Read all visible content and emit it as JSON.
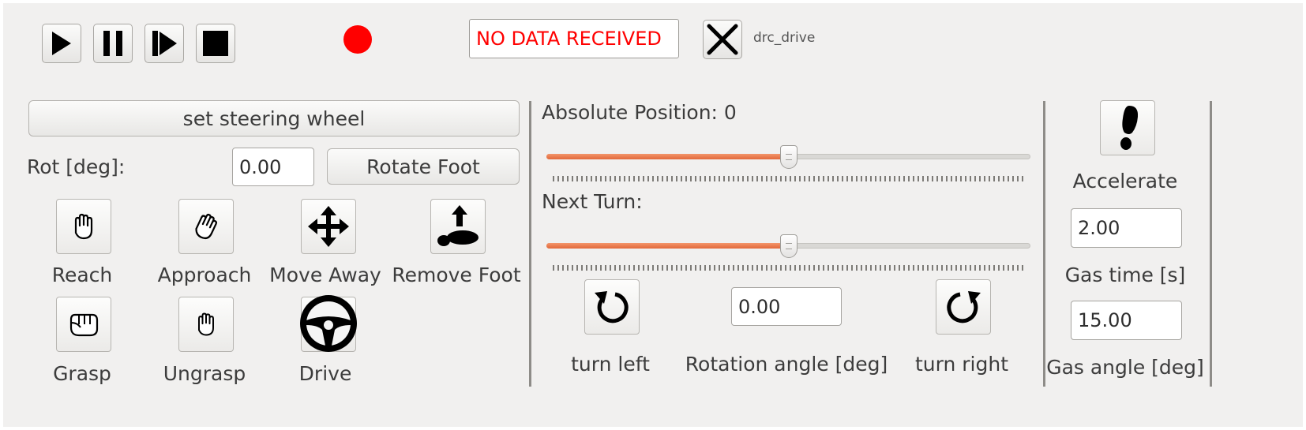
{
  "toolbar": {
    "status_text": "NO DATA RECEIVED",
    "plugin_name": "drc_drive",
    "status_color": "#ff0000",
    "record_indicator_color": "#ff0000"
  },
  "left": {
    "set_steering_wheel_label": "set steering wheel",
    "rot_label": "Rot [deg]:",
    "rot_value": "0.00",
    "rotate_foot_label": "Rotate Foot",
    "actions": [
      {
        "label": "Reach"
      },
      {
        "label": "Approach"
      },
      {
        "label": "Move Away"
      },
      {
        "label": "Remove Foot"
      },
      {
        "label": "Grasp"
      },
      {
        "label": "Ungrasp"
      },
      {
        "label": "Drive"
      }
    ]
  },
  "middle": {
    "absolute_position_label": "Absolute Position: 0",
    "absolute_position_slider": 0.5,
    "next_turn_label": "Next Turn:",
    "next_turn_slider": 0.5,
    "turn_left_label": "turn left",
    "rotation_angle_label": "Rotation angle [deg]",
    "rotation_angle_value": "0.00",
    "turn_right_label": "turn right"
  },
  "right": {
    "accelerate_label": "Accelerate",
    "gas_time_value": "2.00",
    "gas_time_label": "Gas time [s]",
    "gas_angle_value": "15.00",
    "gas_angle_label": "Gas angle [deg]"
  },
  "colors": {
    "panel_bg": "#f1f0ef",
    "slider_fill": "#e8703f",
    "status_red": "#ff0000"
  }
}
